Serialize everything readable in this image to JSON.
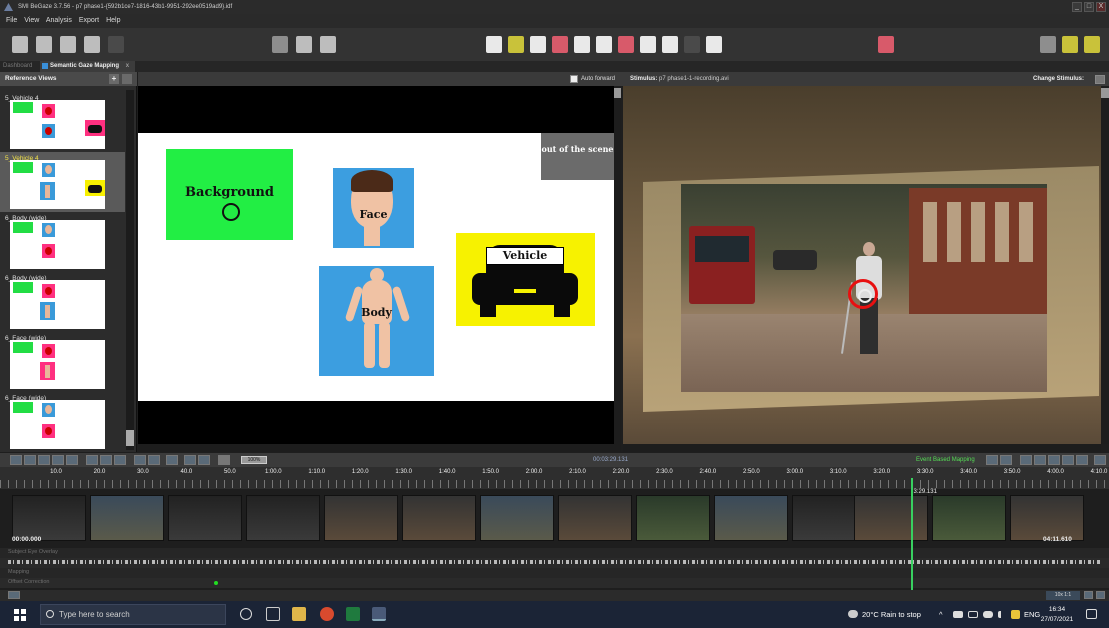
{
  "window": {
    "title": "SMI BeGaze 3.7.56 - p7 phase1-{592b1ce7-1816-43b1-9951-292ee0519ad9}.idf",
    "min": "_",
    "max": "□",
    "close": "X"
  },
  "menu": {
    "items": [
      "File",
      "View",
      "Analysis",
      "Export",
      "Help"
    ]
  },
  "tabs": {
    "dashboard": "Dashboard",
    "active": "Semantic Gaze Mapping",
    "close": "x"
  },
  "reference_views": {
    "header": "Reference Views",
    "add": "+",
    "items": [
      {
        "label": "5_Vehicle 4",
        "selected": false
      },
      {
        "label": "5_Vehicle 4",
        "selected": true
      },
      {
        "label": "6_Body (wide)",
        "selected": false
      },
      {
        "label": "6_Body (wide)",
        "selected": false
      },
      {
        "label": "6_Face (wide)",
        "selected": false
      },
      {
        "label": "6_Face (wide)",
        "selected": false
      }
    ]
  },
  "reference_image": {
    "aois": {
      "background": "Background",
      "face": "Face",
      "body": "Body",
      "vehicle": "Vehicle",
      "out_of_scene": "out of the scene"
    }
  },
  "stimulus_header": {
    "auto_forward": "Auto forward",
    "stimulus_label": "Stimulus:",
    "stimulus_value": "p7 phase1-1-recording.avi",
    "change_stimulus": "Change Stimulus:"
  },
  "controls": {
    "speed": "100%",
    "current_time": "00:03:29.131",
    "mode": "Event Based Mapping"
  },
  "timeline": {
    "ticks": [
      "10.0",
      "20.0",
      "30.0",
      "40.0",
      "50.0",
      "1:00.0",
      "1:10.0",
      "1:20.0",
      "1:30.0",
      "1:40.0",
      "1:50.0",
      "2:00.0",
      "2:10.0",
      "2:20.0",
      "2:30.0",
      "2:40.0",
      "2:50.0",
      "3:00.0",
      "3:10.0",
      "3:20.0",
      "3:30.0",
      "3:40.0",
      "3:50.0",
      "4:00.0",
      "4:10.0"
    ],
    "playhead_time": "3:29.131",
    "start_time": "00:00.000",
    "end_time": "04:11.610",
    "playhead_fraction": 0.832,
    "tracks": [
      "Subject Eye Overlay",
      "Mapping",
      "Offset Correction"
    ],
    "zoom": "10x 1:1"
  },
  "taskbar": {
    "search_placeholder": "Type here to search",
    "weather": "20°C  Rain to stop",
    "language": "ENG",
    "time": "16:34",
    "date": "27/07/2021"
  }
}
